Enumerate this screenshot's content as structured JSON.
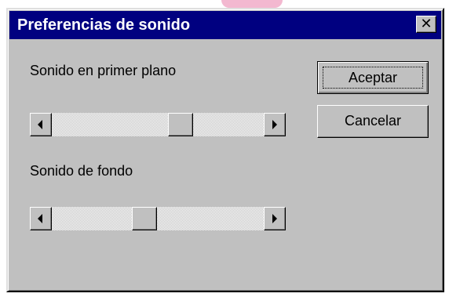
{
  "dialog": {
    "title": "Preferencias de sonido",
    "close_glyph": "✕"
  },
  "foreground_sound": {
    "label": "Sonido en primer plano",
    "level": 0.62
  },
  "background_sound": {
    "label": "Sonido de fondo",
    "level": 0.43
  },
  "buttons": {
    "accept_label": "Aceptar",
    "cancel_label": "Cancelar"
  },
  "icons": {
    "close": "close-icon",
    "scroll_left": "arrow-left-icon",
    "scroll_right": "arrow-right-icon"
  },
  "colors": {
    "titlebar": "#000080",
    "face": "#c0c0c0"
  }
}
